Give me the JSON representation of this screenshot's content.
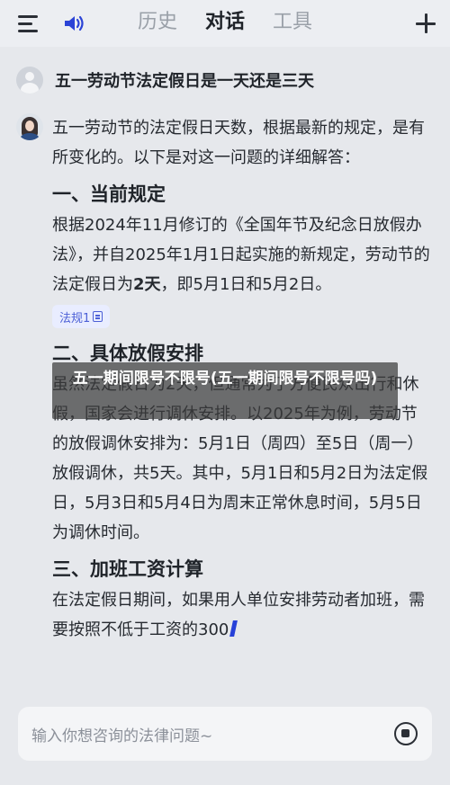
{
  "header": {
    "tabs": [
      {
        "label": "历史"
      },
      {
        "label": "对话"
      },
      {
        "label": "工具"
      }
    ]
  },
  "conversation": {
    "user_question": "五一劳动节法定假日是一天还是三天",
    "answer": {
      "intro": "五一劳动节的法定假日天数，根据最新的规定，是有所变化的。以下是对这一问题的详细解答：",
      "section1_title": "一、当前规定",
      "section1_text_a": "根据2024年11月修订的《全国年节及纪念日放假办法》，并自2025年1月1日起实施的新规定，劳动节的法定假日为",
      "section1_bold": "2天",
      "section1_text_b": "，即5月1日和5月2日。",
      "law_tag": "法规1",
      "section2_title": "二、具体放假安排",
      "section2_text": "虽然法定假日为2天，但通常为了方便民众出行和休假，国家会进行调休安排。以2025年为例，劳动节的放假调休安排为：5月1日（周四）至5日（周一）放假调休，共5天。其中，5月1日和5月2日为法定假日，5月3日和5月4日为周末正常休息时间，5月5日为调休时间。",
      "section3_title": "三、加班工资计算",
      "section3_text": "在法定假日期间，如果用人单位安排劳动者加班，需要按照不低于工资的300"
    }
  },
  "overlay_banner": "五一期间限号不限号(五一期间限号不限号吗)",
  "input": {
    "placeholder": "输入你想咨询的法律问题~"
  },
  "colors": {
    "background": "#e6e8ec",
    "accent": "#4b5fd6",
    "cursor": "#2741d8"
  },
  "icons": [
    "menu-icon",
    "speaker-icon",
    "plus-icon",
    "user-avatar-icon",
    "assistant-avatar-icon",
    "document-icon",
    "stop-icon"
  ]
}
